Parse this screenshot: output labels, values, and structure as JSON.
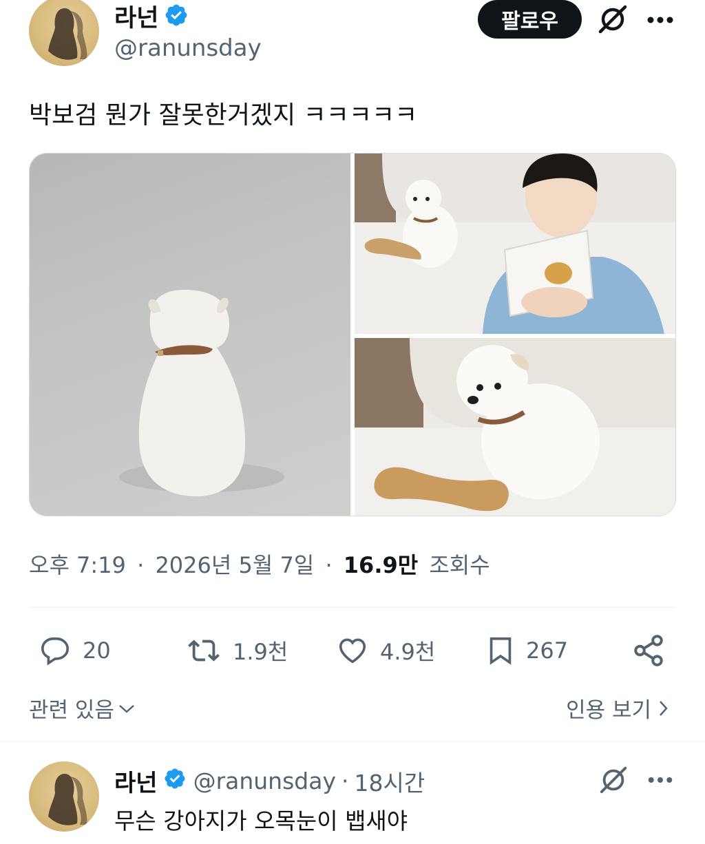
{
  "tweet": {
    "author": {
      "display_name": "라넌",
      "handle": "@ranunsday",
      "verified": true
    },
    "follow_label": "팔로우",
    "text": "박보검 뭔가 잘못한거겠지 ㅋㅋㅋㅋㅋ",
    "meta": {
      "time": "오후 7:19",
      "separator": "·",
      "date": "2026년 5월 7일",
      "views_count": "16.9만",
      "views_label": "조회수"
    },
    "actions": {
      "replies": "20",
      "retweets": "1.9천",
      "likes": "4.9천",
      "bookmarks": "267"
    },
    "related_label": "관련 있음",
    "quotes_label": "인용 보기"
  },
  "reply": {
    "display_name": "라넌",
    "handle": "@ranunsday",
    "separator": "·",
    "time": "18시간",
    "text": "무슨 강아지가 오목눈이 뱁새야"
  },
  "colors": {
    "text_primary": "#0f1419",
    "text_secondary": "#536471",
    "verified_blue": "#1d9bf0",
    "follow_button_bg": "#0f1419"
  },
  "icons": [
    "verified-badge-icon",
    "grok-icon",
    "more-icon",
    "reply-icon",
    "retweet-icon",
    "like-icon",
    "bookmark-icon",
    "share-icon",
    "chevron-down-icon",
    "chevron-right-icon"
  ]
}
